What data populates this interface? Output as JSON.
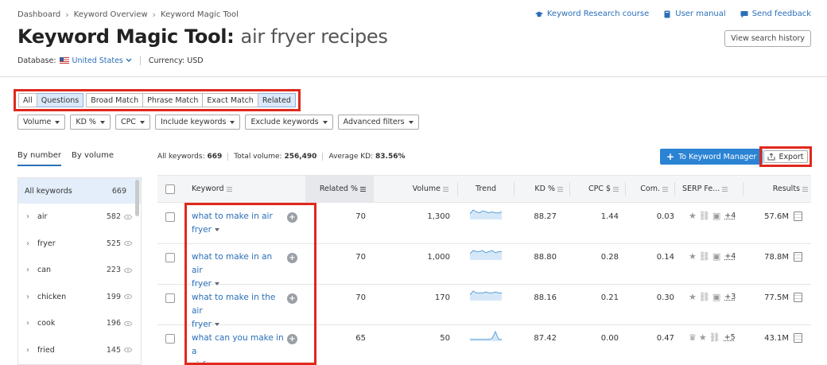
{
  "breadcrumb": [
    "Dashboard",
    "Keyword Overview",
    "Keyword Magic Tool"
  ],
  "top_links": {
    "course": "Keyword Research course",
    "manual": "User manual",
    "feedback": "Send feedback"
  },
  "title": {
    "tool": "Keyword Magic Tool:",
    "query": "air fryer recipes"
  },
  "view_history": "View search history",
  "database": {
    "label": "Database:",
    "value": "United States",
    "currency_label": "Currency: USD"
  },
  "match_tabs": [
    "All",
    "Questions",
    "Broad Match",
    "Phrase Match",
    "Exact Match",
    "Related"
  ],
  "filters": [
    "Volume",
    "KD %",
    "CPC",
    "Include keywords",
    "Exclude keywords",
    "Advanced filters"
  ],
  "sort_tabs": {
    "by_number": "By number",
    "by_volume": "By volume"
  },
  "groups": [
    {
      "label": "All keywords",
      "count": "669"
    },
    {
      "label": "air",
      "count": "582"
    },
    {
      "label": "fryer",
      "count": "525"
    },
    {
      "label": "can",
      "count": "223"
    },
    {
      "label": "chicken",
      "count": "199"
    },
    {
      "label": "cook",
      "count": "196"
    },
    {
      "label": "fried",
      "count": "145"
    }
  ],
  "stats": {
    "all_label": "All keywords:",
    "all_value": "669",
    "volume_label": "Total volume:",
    "volume_value": "256,490",
    "kd_label": "Average KD:",
    "kd_value": "83.56%"
  },
  "buttons": {
    "keyword_manager": "To Keyword Manager",
    "export": "Export"
  },
  "columns": [
    "Keyword",
    "Related %",
    "Volume",
    "Trend",
    "KD %",
    "CPC $",
    "Com.",
    "SERP Fe...",
    "Results"
  ],
  "rows": [
    {
      "kw1": "what to make in air",
      "kw2": "fryer",
      "related": "70",
      "volume": "1,300",
      "kd": "88.27",
      "cpc": "1.44",
      "com": "0.03",
      "serp_more": "+4",
      "results": "57.6M",
      "trend": [
        5,
        9,
        7,
        6,
        8,
        7,
        6,
        7,
        6,
        6,
        7
      ]
    },
    {
      "kw1": "what to make in an air",
      "kw2": "fryer",
      "related": "70",
      "volume": "1,000",
      "kd": "88.80",
      "cpc": "0.28",
      "com": "0.14",
      "serp_more": "+4",
      "results": "78.8M",
      "trend": [
        5,
        8,
        7,
        7,
        8,
        6,
        7,
        8,
        6,
        7,
        7
      ]
    },
    {
      "kw1": "what to make in the air",
      "kw2": "fryer",
      "related": "70",
      "volume": "170",
      "kd": "88.16",
      "cpc": "0.21",
      "com": "0.30",
      "serp_more": "+3",
      "results": "77.5M",
      "trend": [
        5,
        9,
        7,
        7,
        7,
        8,
        7,
        7,
        8,
        7,
        7
      ]
    },
    {
      "kw1": "what can you make in a",
      "kw2": "airfryer",
      "related": "65",
      "volume": "50",
      "kd": "87.42",
      "cpc": "0.00",
      "com": "0.47",
      "serp_more": "+5",
      "results": "43.1M",
      "trend": [
        1,
        1,
        1,
        1,
        1,
        1,
        1,
        2,
        9,
        1,
        1
      ]
    }
  ]
}
